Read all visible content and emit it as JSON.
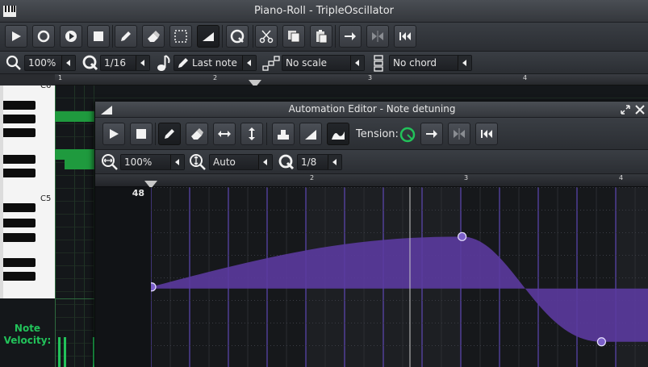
{
  "piano_roll": {
    "window_title": "Piano-Roll - TripleOscillator",
    "zoom": "100%",
    "quantize": "1/16",
    "note_length": "Last note",
    "scale": "No scale",
    "chord": "No chord",
    "timeline_marks": [
      "1",
      "2",
      "3",
      "4"
    ],
    "octave_labels": [
      "C6",
      "C5"
    ],
    "velocity_label": "Note\nVelocity:"
  },
  "automation_editor": {
    "window_title": "Automation Editor - Note detuning",
    "tension_label": "Tension:",
    "zoom_x": "100%",
    "zoom_y": "Auto",
    "quantize": "1/8",
    "timeline_marks": [
      "2",
      "3",
      "4"
    ],
    "y_max_label": "48",
    "graph": {
      "curve_color": "#5b3a9e",
      "point_color": "#7b5fc9",
      "points_fraction": [
        [
          0.0,
          0.555
        ],
        [
          0.625,
          0.275
        ],
        [
          0.905,
          0.86
        ]
      ]
    }
  },
  "colors": {
    "accent_green": "#22c25a",
    "grid_purple": "#6a4fd0",
    "note_green": "#1f9a3e"
  }
}
